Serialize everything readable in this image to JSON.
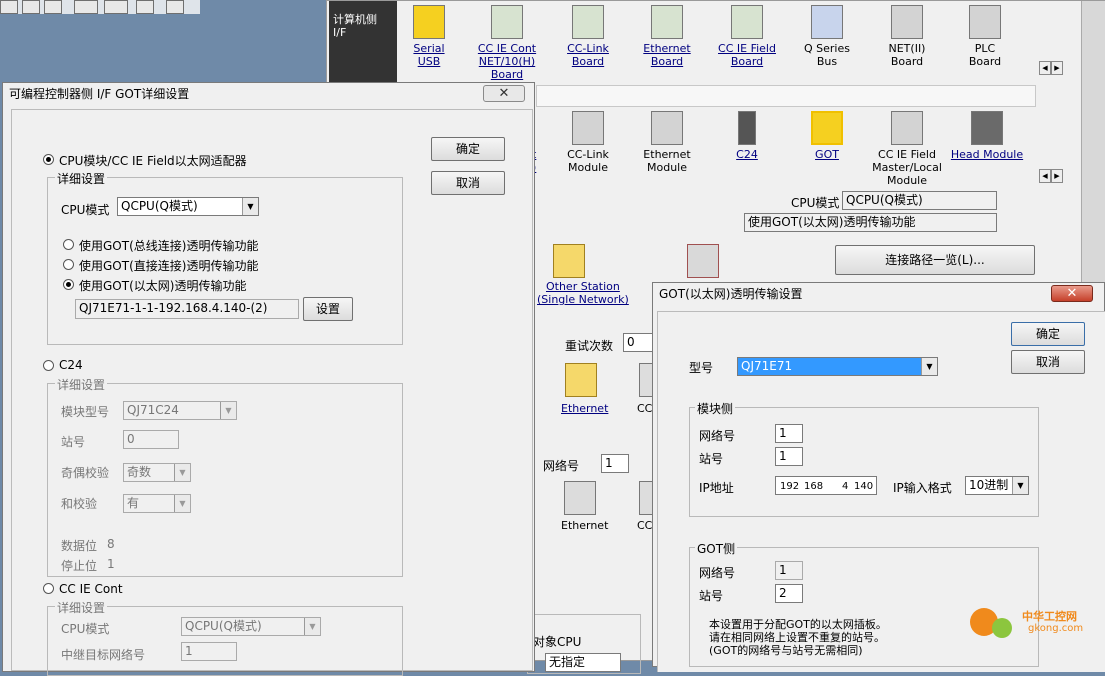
{
  "bg_window": {
    "pc_side_label": "计算机侧\nI/F",
    "pc_items": [
      {
        "label": "Serial\nUSB"
      },
      {
        "label": "CC IE Cont\nNET/10(H)\nBoard"
      },
      {
        "label": "CC-Link\nBoard"
      },
      {
        "label": "Ethernet\nBoard"
      },
      {
        "label": "CC IE Field\nBoard"
      },
      {
        "label": "Q Series\nBus"
      },
      {
        "label": "NET(II)\nBoard"
      },
      {
        "label": "PLC\nBoard"
      }
    ],
    "plc_items": [
      {
        "label": "CC-Link\nModule"
      },
      {
        "label": "Ethernet\nModule"
      },
      {
        "label": "C24"
      },
      {
        "label": "GOT"
      },
      {
        "label": "CC IE Field\nMaster/Local\nModule"
      },
      {
        "label": "Head Module"
      }
    ],
    "plc_partial_label": "t\n)",
    "cpu_mode_label": "CPU模式",
    "cpu_mode_value": "QCPU(Q模式)",
    "transparent_value": "使用GOT(以太网)透明传输功能",
    "other_station_label": "Other Station\n(Single Network)",
    "route_list_button": "连接路径一览(L)...",
    "retry_label": "重试次数",
    "retry_value": "0",
    "ethernet_label": "Ethernet",
    "cc_partial": "CC",
    "network_no_label": "网络号",
    "network_no_value": "1",
    "ethernet2_label": "Ethernet",
    "cc_partial2": "CC",
    "target_cpu_label": "对象CPU",
    "target_cpu_value": "无指定"
  },
  "dlg1": {
    "title": "可编程控制器侧 I/F GOT详细设置",
    "ok": "确定",
    "cancel": "取消",
    "opt_cpu": "CPU模块/CC IE Field以太网适配器",
    "detail_title": "详细设置",
    "cpu_mode_label": "CPU模式",
    "cpu_mode_value": "QCPU(Q模式)",
    "r1": "使用GOT(总线连接)透明传输功能",
    "r2": "使用GOT(直接连接)透明传输功能",
    "r3": "使用GOT(以太网)透明传输功能",
    "path_value": "QJ71E71-1-1-192.168.4.140-(2)",
    "set_button": "设置",
    "opt_c24": "C24",
    "c24_detail_title": "详细设置",
    "model_label": "模块型号",
    "model_value": "QJ71C24",
    "station_label": "站号",
    "station_value": "0",
    "parity_label": "奇偶校验",
    "parity_value": "奇数",
    "sum_label": "和校验",
    "sum_value": "有",
    "data_bits_label": "数据位",
    "data_bits_value": "8",
    "stop_bits_label": "停止位",
    "stop_bits_value": "1",
    "opt_ccie": "CC IE Cont",
    "ccie_detail_title": "详细设置",
    "ccie_cpu_label": "CPU模式",
    "ccie_cpu_value": "QCPU(Q模式)",
    "relay_label": "中继目标网络号",
    "relay_value": "1"
  },
  "dlg2": {
    "title": "GOT(以太网)透明传输设置",
    "ok": "确定",
    "cancel": "取消",
    "model_label": "型号",
    "model_value": "QJ71E71",
    "module_side_title": "模块侧",
    "net_label": "网络号",
    "net_value": "1",
    "station_label": "站号",
    "station_value": "1",
    "ip_label": "IP地址",
    "ip": [
      "192",
      "168",
      "4",
      "140"
    ],
    "ip_format_label": "IP输入格式",
    "ip_format_value": "10进制",
    "got_side_title": "GOT侧",
    "got_net_label": "网络号",
    "got_net_value": "1",
    "got_station_label": "站号",
    "got_station_value": "2",
    "note1": "本设置用于分配GOT的以太网插板。",
    "note2": "请在相同网络上设置不重复的站号。",
    "note3": "(GOT的网络号与站号无需相同)"
  },
  "watermark": {
    "line1": "中华工控网",
    "line2": "gkong.com"
  }
}
